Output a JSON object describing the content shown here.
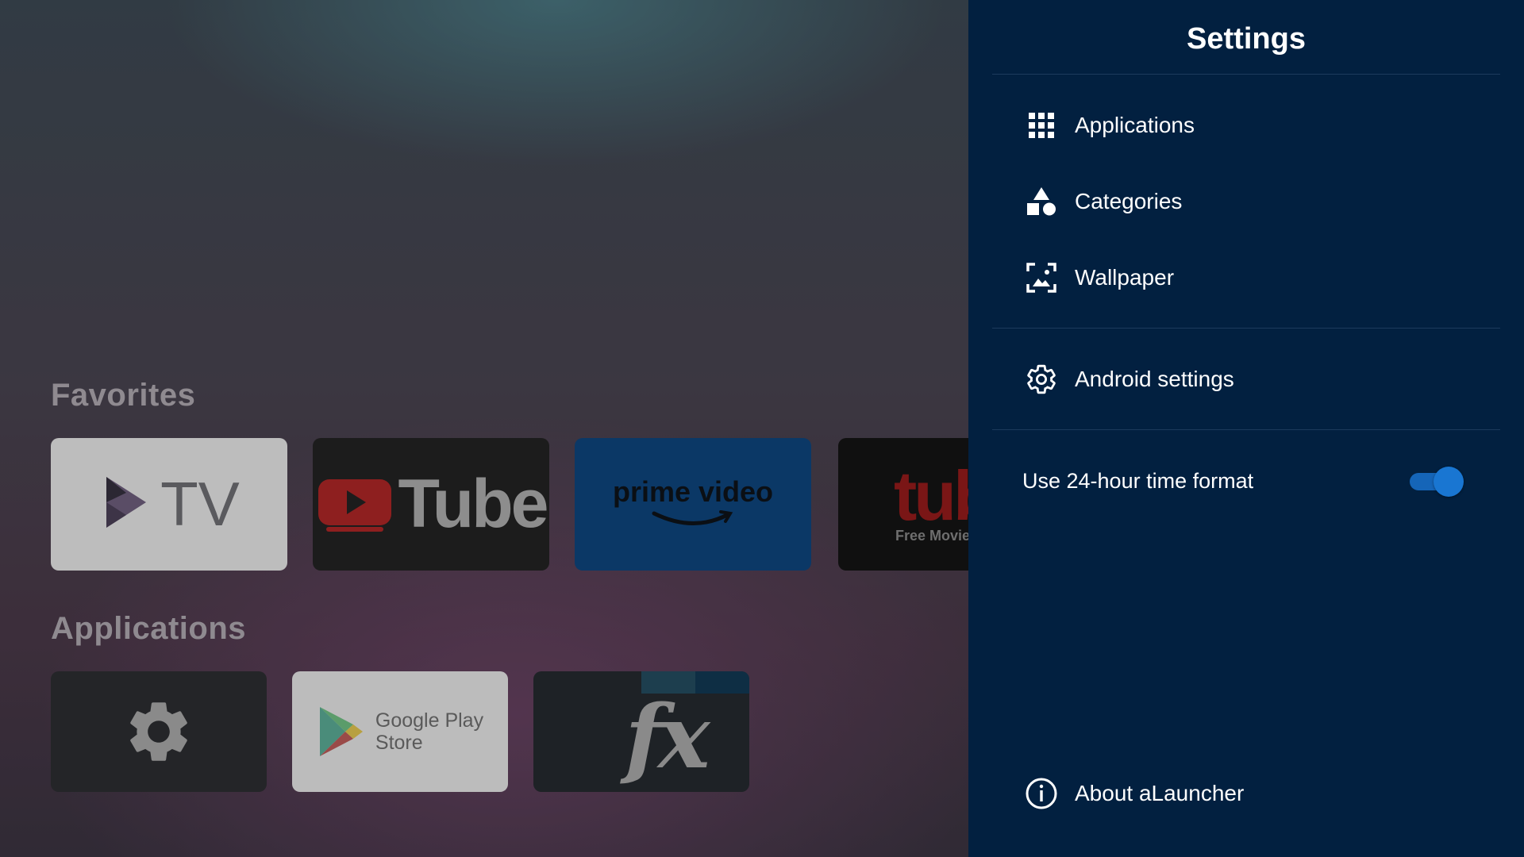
{
  "launcher": {
    "favorites_title": "Favorites",
    "applications_title": "Applications",
    "favorites": [
      {
        "name": "TV",
        "label": "TV"
      },
      {
        "name": "YouTube",
        "label": "Tube"
      },
      {
        "name": "Prime Video",
        "label": "prime video"
      },
      {
        "name": "Tubi",
        "label": "tubi",
        "sublabel": "Free Movie"
      }
    ],
    "apps": [
      {
        "name": "Settings"
      },
      {
        "name": "Google Play Store",
        "label_line1": "Google Play",
        "label_line2": "Store"
      },
      {
        "name": "FX",
        "label": "fx"
      }
    ]
  },
  "settings": {
    "title": "Settings",
    "items": [
      {
        "label": "Applications",
        "icon": "grid-icon"
      },
      {
        "label": "Categories",
        "icon": "shapes-icon"
      },
      {
        "label": "Wallpaper",
        "icon": "wallpaper-icon"
      },
      {
        "label": "Android settings",
        "icon": "gear-icon"
      }
    ],
    "time_format_label": "Use 24-hour time format",
    "time_format_enabled": true,
    "about_label": "About aLauncher",
    "accent_color": "#1976d2",
    "panel_color": "#022040"
  }
}
